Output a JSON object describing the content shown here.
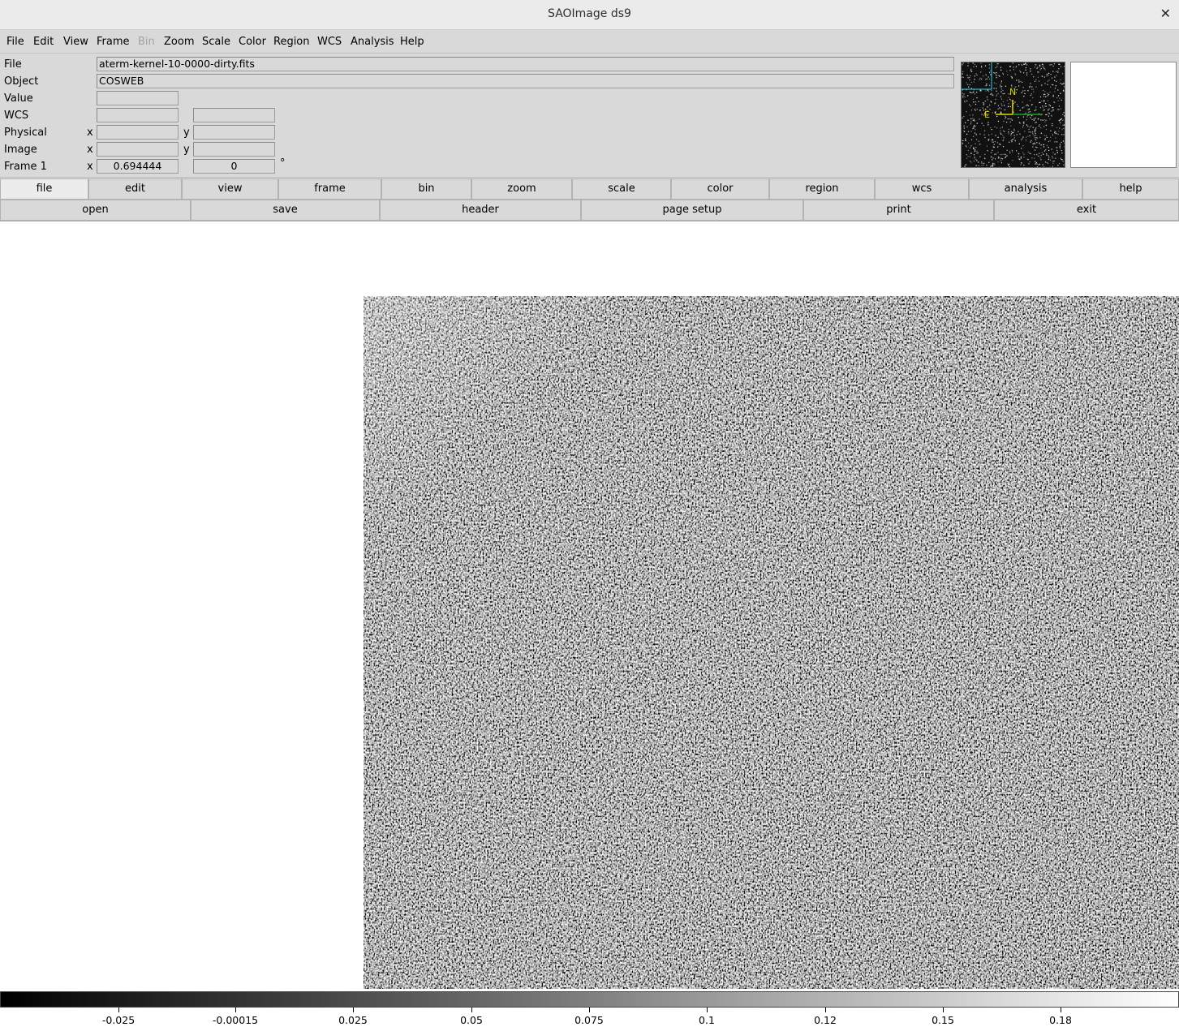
{
  "window": {
    "title": "SAOImage ds9"
  },
  "menubar": {
    "items": [
      {
        "label": "File",
        "enabled": true
      },
      {
        "label": "Edit",
        "enabled": true
      },
      {
        "label": "View",
        "enabled": true
      },
      {
        "label": "Frame",
        "enabled": true
      },
      {
        "label": "Bin",
        "enabled": false
      },
      {
        "label": "Zoom",
        "enabled": true
      },
      {
        "label": "Scale",
        "enabled": true
      },
      {
        "label": "Color",
        "enabled": true
      },
      {
        "label": "Region",
        "enabled": true
      },
      {
        "label": "WCS",
        "enabled": true
      },
      {
        "label": "Analysis",
        "enabled": true
      },
      {
        "label": "Help",
        "enabled": true
      }
    ]
  },
  "info": {
    "file_label": "File",
    "file_value": "aterm-kernel-10-0000-dirty.fits",
    "object_label": "Object",
    "object_value": "COSWEB",
    "value_label": "Value",
    "value_value": "",
    "wcs_label": "WCS",
    "wcs_value1": "",
    "wcs_value2": "",
    "physical_label": "Physical",
    "physical_x": "",
    "physical_y": "",
    "image_label": "Image",
    "image_x": "",
    "image_y": "",
    "frame_label": "Frame 1",
    "frame_zoom": "0.694444",
    "frame_angle": "0",
    "x_label": "x",
    "y_label": "y",
    "degree_symbol": "°"
  },
  "panner": {
    "north_label": "N",
    "east_label": "E"
  },
  "buttons": {
    "main": [
      {
        "label": "file",
        "active": true
      },
      {
        "label": "edit"
      },
      {
        "label": "view"
      },
      {
        "label": "frame"
      },
      {
        "label": "bin"
      },
      {
        "label": "zoom"
      },
      {
        "label": "scale"
      },
      {
        "label": "color"
      },
      {
        "label": "region"
      },
      {
        "label": "wcs"
      },
      {
        "label": "analysis"
      },
      {
        "label": "help"
      }
    ],
    "file": [
      {
        "label": "open"
      },
      {
        "label": "save"
      },
      {
        "label": "header"
      },
      {
        "label": "page setup"
      },
      {
        "label": "print"
      },
      {
        "label": "exit"
      }
    ]
  },
  "colorbar": {
    "colormap": "grey",
    "ticks": [
      {
        "label": "-0.025"
      },
      {
        "label": "-0.00015"
      },
      {
        "label": "0.025"
      },
      {
        "label": "0.05"
      },
      {
        "label": "0.075"
      },
      {
        "label": "0.1"
      },
      {
        "label": "0.12"
      },
      {
        "label": "0.15"
      },
      {
        "label": "0.18"
      }
    ]
  },
  "colors": {
    "panel_bg": "#d9d9d9",
    "panner_axis_yellow": "#e0d800",
    "panner_axis_green": "#22c02a",
    "panner_view_cyan": "#29b7c5"
  }
}
